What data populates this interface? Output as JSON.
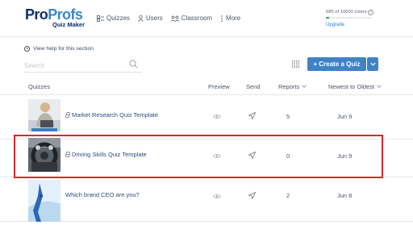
{
  "brand": {
    "name_part1": "Pro",
    "name_part2": "Profs",
    "product": "Quiz Maker"
  },
  "nav": [
    {
      "label": "Quizzes",
      "icon": "quiz-grid-icon"
    },
    {
      "label": "Users",
      "icon": "user-icon"
    },
    {
      "label": "Classroom",
      "icon": "classroom-icon"
    },
    {
      "label": "More",
      "icon": "more-dots-icon"
    }
  ],
  "usage": {
    "text": "685 of 10000 Users",
    "fraction": 0.0685,
    "upgrade": "Upgrade"
  },
  "help": {
    "link": "View help for this section"
  },
  "search": {
    "placeholder": "Search"
  },
  "toolbar": {
    "create": "+ Create a Quiz"
  },
  "table": {
    "headers": {
      "quizzes": "Quizzes",
      "preview": "Preview",
      "send": "Send",
      "reports": "Reports",
      "sort": "Newest to Oldest"
    },
    "rows": [
      {
        "title": "Market Research Quiz Template",
        "locked": true,
        "reports": "5",
        "date": "Jun 9",
        "image": "man-with-laptop"
      },
      {
        "title": "Driving Skills Quiz Template",
        "locked": true,
        "reports": "0",
        "date": "Jun 9",
        "image": "car-dashboard"
      },
      {
        "title": "Which brand CEO are you?",
        "locked": false,
        "reports": "2",
        "date": "Jun 8",
        "image": "blue-abstract"
      }
    ]
  },
  "colors": {
    "accent": "#3f83c6",
    "highlight": "#e0232d",
    "brand_dark": "#0d2f6b",
    "link": "#2f4a7c"
  }
}
